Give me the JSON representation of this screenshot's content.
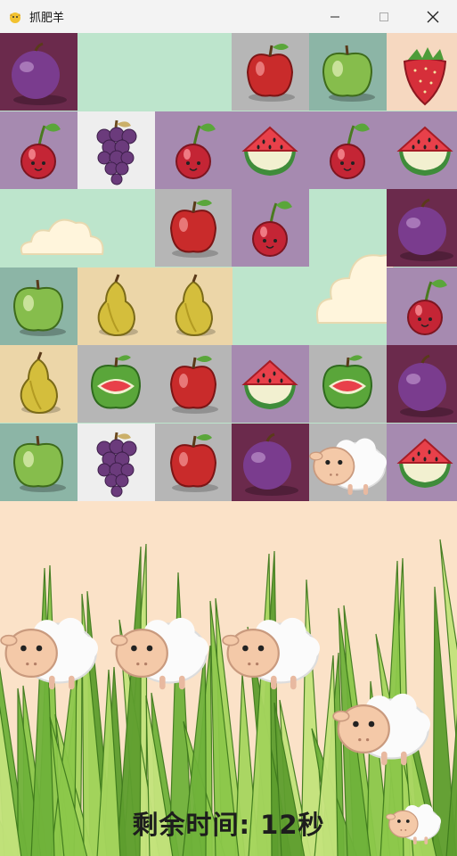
{
  "window": {
    "title": "抓肥羊"
  },
  "colors": {
    "plum": "#6b2a4c",
    "purple": "#a68ab0",
    "tan": "#ecd6a8",
    "gray": "#b6b6b6",
    "teal": "#8cb5a6",
    "peach": "#f6d8c0",
    "mint": "#bde5cc",
    "white": "#eeeeee",
    "grass": "#7fbe3c",
    "sky": "#fbe2c8"
  },
  "board": {
    "rows": 6,
    "cols": 6,
    "tiles": [
      [
        {
          "item": "plum-icon",
          "bg": "plum"
        },
        {
          "item": "empty",
          "bg": "mint"
        },
        {
          "item": "empty",
          "bg": "mint"
        },
        {
          "item": "red-apple-icon",
          "bg": "gray"
        },
        {
          "item": "green-apple-icon",
          "bg": "teal"
        },
        {
          "item": "strawberry-icon",
          "bg": "peach"
        }
      ],
      [
        {
          "item": "cherry-icon",
          "bg": "purple"
        },
        {
          "item": "grape-icon",
          "bg": "white"
        },
        {
          "item": "cherry-icon",
          "bg": "purple"
        },
        {
          "item": "watermelon-icon",
          "bg": "purple"
        },
        {
          "item": "cherry-icon",
          "bg": "purple"
        },
        {
          "item": "watermelon-icon",
          "bg": "purple"
        }
      ],
      [
        {
          "item": "empty",
          "bg": "mint"
        },
        {
          "item": "empty",
          "bg": "mint"
        },
        {
          "item": "red-apple-icon",
          "bg": "gray"
        },
        {
          "item": "cherry-icon",
          "bg": "purple"
        },
        {
          "item": "empty",
          "bg": "mint"
        },
        {
          "item": "plum-icon",
          "bg": "plum"
        }
      ],
      [
        {
          "item": "green-apple-icon",
          "bg": "teal"
        },
        {
          "item": "pear-icon",
          "bg": "tan"
        },
        {
          "item": "pear-icon",
          "bg": "tan"
        },
        {
          "item": "empty",
          "bg": "mint"
        },
        {
          "item": "empty",
          "bg": "mint"
        },
        {
          "item": "cherry-icon",
          "bg": "purple"
        }
      ],
      [
        {
          "item": "pear-icon",
          "bg": "tan"
        },
        {
          "item": "melon-apple-icon",
          "bg": "gray"
        },
        {
          "item": "red-apple-icon",
          "bg": "gray"
        },
        {
          "item": "watermelon-icon",
          "bg": "purple"
        },
        {
          "item": "melon-apple-icon",
          "bg": "gray"
        },
        {
          "item": "plum-icon",
          "bg": "plum"
        }
      ],
      [
        {
          "item": "green-apple-icon",
          "bg": "teal"
        },
        {
          "item": "grape-icon",
          "bg": "white"
        },
        {
          "item": "red-apple-icon",
          "bg": "gray"
        },
        {
          "item": "plum-icon",
          "bg": "plum"
        },
        {
          "item": "sheep-icon",
          "bg": "gray"
        },
        {
          "item": "watermelon-icon",
          "bg": "purple"
        }
      ]
    ]
  },
  "field": {
    "sheep": [
      {
        "name": "sheep-icon"
      },
      {
        "name": "sheep-icon"
      },
      {
        "name": "sheep-icon"
      },
      {
        "name": "sheep-icon"
      },
      {
        "name": "sheep-icon"
      }
    ]
  },
  "status": {
    "timer_text": "剩余时间: 12秒"
  }
}
